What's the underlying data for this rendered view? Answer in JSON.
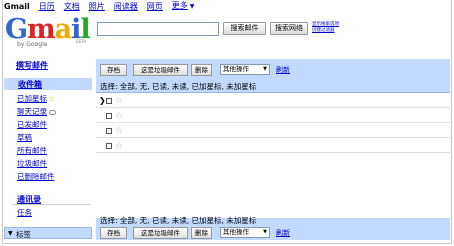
{
  "topnav": {
    "items": [
      "Gmail",
      "日历",
      "文档",
      "照片",
      "阅读器",
      "网页",
      "更多"
    ],
    "more_arrow": "▼"
  },
  "logo": {
    "text": "Gmail",
    "by": "by Google",
    "beta": "BETA"
  },
  "search": {
    "mail_button": "搜索邮件",
    "web_button": "搜索网络",
    "options_link": "显示搜索选项",
    "filter_link": "创建过滤器"
  },
  "sidebar": {
    "compose": "撰写邮件",
    "inbox": "收件箱",
    "items": [
      "已加星标",
      "聊天记录",
      "已发邮件",
      "草稿",
      "所有邮件",
      "垃圾邮件",
      "已删除邮件"
    ],
    "contacts": "通讯录",
    "tasks": "任务",
    "labels": "标签",
    "labels_arrow": "▼"
  },
  "toolbar": {
    "archive": "存档",
    "spam": "这是垃圾邮件",
    "delete": "删除",
    "more_actions": "其他操作",
    "refresh": "刷新",
    "select_line": "选择: 全部, 无, 已读, 未读, 已加星标, 未加星标"
  },
  "rows": [
    {
      "pointer": "❯"
    },
    {
      "pointer": ""
    },
    {
      "pointer": ""
    },
    {
      "pointer": ""
    }
  ],
  "icons": {
    "star": "star-icon",
    "chat": "chat-bubble-icon",
    "dropdown": "chevron-down-icon"
  },
  "colors": {
    "nav_blue": "#c3d9ff",
    "link": "#0000cc"
  }
}
